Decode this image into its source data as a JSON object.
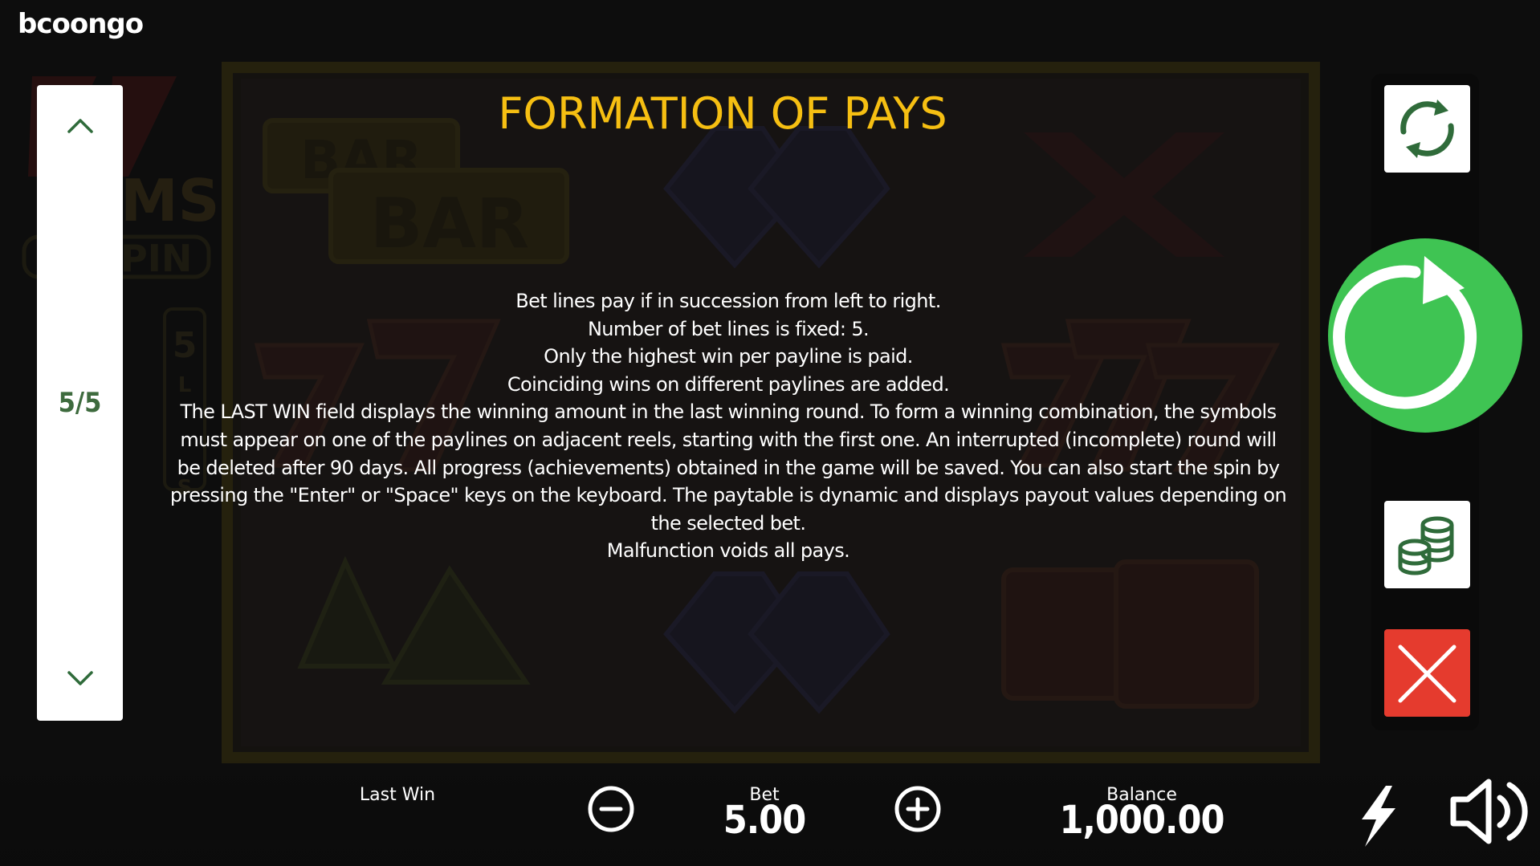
{
  "brand": {
    "logo_text": "bcoongo"
  },
  "pager": {
    "page_indicator": "5/5"
  },
  "rules": {
    "title": "FORMATION OF PAYS",
    "paragraphs": [
      "Bet lines pay if in succession from left to right.",
      "Number of bet lines is fixed: 5.",
      "Only the highest win per payline is paid.",
      "Coinciding wins on different paylines are added.",
      "The LAST WIN field displays the winning amount in the last winning round. To form a winning combination, the symbols must appear on one of the paylines on adjacent reels, starting with the first one. An interrupted (incomplete) round will be deleted after 90 days. All progress (achievements) obtained in the game will be saved. You can also start the spin by pressing the \"Enter\" or \"Space\" keys on the keyboard. The paytable is dynamic and displays payout values depending on the selected bet.",
      "Malfunction voids all pays."
    ]
  },
  "footer": {
    "last_win_label": "Last Win",
    "bet_label": "Bet",
    "bet_value": "5.00",
    "balance_label": "Balance",
    "balance_value": "1,000.00"
  },
  "background_text": {
    "bar_small": "BAR",
    "bar_large": "BAR",
    "logo_ms": "MS",
    "logo_pin": "PIN",
    "lines_digit": "5",
    "lines_l": "L",
    "lines_s": "S"
  },
  "colors": {
    "title": "#f6bf12",
    "spin_button": "#3fc453",
    "close_button": "#e53b2e",
    "icon_green": "#2f6b3a",
    "pager_text": "#3e6b3e"
  },
  "icons": {
    "pager_up": "chevron-up-icon",
    "pager_down": "chevron-down-icon",
    "autoplay": "refresh-icon",
    "spin": "spin-arrow-icon",
    "stake": "coins-icon",
    "close": "close-icon",
    "minus": "minus-circle-icon",
    "plus": "plus-circle-icon",
    "turbo": "lightning-icon",
    "sound": "speaker-icon"
  }
}
